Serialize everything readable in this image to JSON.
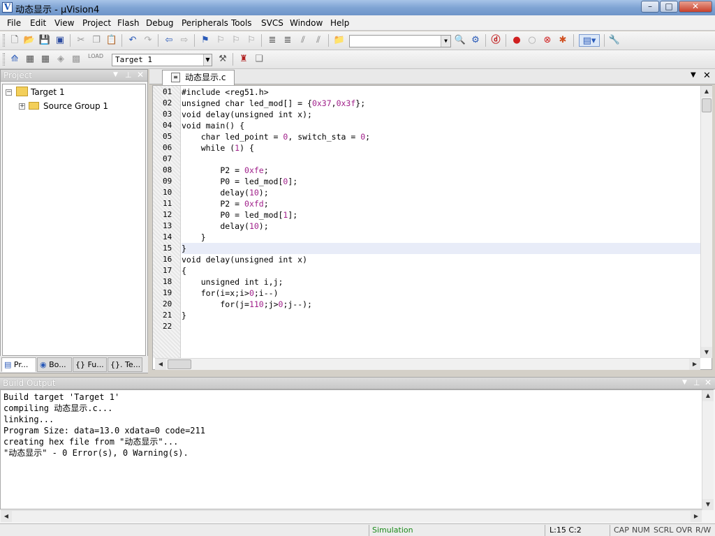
{
  "window": {
    "title": "动态显示  - µVision4",
    "app_icon_letter": "V",
    "min": "–",
    "max": "□",
    "close": "✕"
  },
  "menu": [
    "File",
    "Edit",
    "View",
    "Project",
    "Flash",
    "Debug",
    "Peripherals",
    "Tools",
    "SVCS",
    "Window",
    "Help"
  ],
  "toolbar2": {
    "target_select": "Target 1",
    "load_label": "LOAD"
  },
  "project_panel": {
    "title": "Project",
    "tree": [
      {
        "label": "Target 1"
      },
      {
        "label": "Source Group 1"
      }
    ],
    "tabs": [
      "Pr...",
      "Bo...",
      "{} Fu...",
      "{}. Te..."
    ]
  },
  "editor": {
    "tab_label": "动态显示.c",
    "lines": [
      {
        "n": "01",
        "text": "#include <reg51.h>"
      },
      {
        "n": "02",
        "text": "unsigned char led_mod[] = {0x37,0x3f};"
      },
      {
        "n": "03",
        "text": "void delay(unsigned int x);"
      },
      {
        "n": "04",
        "text": "void main() {"
      },
      {
        "n": "05",
        "text": "    char led_point = 0, switch_sta = 0;"
      },
      {
        "n": "06",
        "text": "    while (1) {"
      },
      {
        "n": "07",
        "text": ""
      },
      {
        "n": "08",
        "text": "        P2 = 0xfe;"
      },
      {
        "n": "09",
        "text": "        P0 = led_mod[0];"
      },
      {
        "n": "10",
        "text": "        delay(10);"
      },
      {
        "n": "11",
        "text": "        P2 = 0xfd;"
      },
      {
        "n": "12",
        "text": "        P0 = led_mod[1];"
      },
      {
        "n": "13",
        "text": "        delay(10);"
      },
      {
        "n": "14",
        "text": "    }"
      },
      {
        "n": "15",
        "text": "}"
      },
      {
        "n": "16",
        "text": "void delay(unsigned int x)"
      },
      {
        "n": "17",
        "text": "{"
      },
      {
        "n": "18",
        "text": "    unsigned int i,j;"
      },
      {
        "n": "19",
        "text": "    for(i=x;i>0;i--)"
      },
      {
        "n": "20",
        "text": "        for(j=110;j>0;j--);"
      },
      {
        "n": "21",
        "text": "}"
      },
      {
        "n": "22",
        "text": ""
      }
    ]
  },
  "build_output": {
    "title": "Build Output",
    "lines": [
      "Build target 'Target 1'",
      "compiling 动态显示.c...",
      "linking...",
      "Program Size: data=13.0 xdata=0 code=211",
      "creating hex file from \"动态显示\"...",
      "\"动态显示\" - 0 Error(s), 0 Warning(s)."
    ]
  },
  "status": {
    "mode": "Simulation",
    "position": "L:15 C:2",
    "cap": "CAP",
    "num": "NUM",
    "scrl": "SCRL",
    "ovr": "OVR",
    "rw": "R/W"
  },
  "colors": {
    "mode_text": "#1a8a1a",
    "number_literal": "#a0208a"
  }
}
